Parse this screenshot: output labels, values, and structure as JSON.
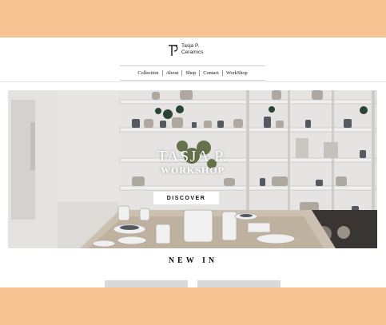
{
  "brand": {
    "line1": "Tasja P.",
    "line2": "Ceramics",
    "logo_icon": "tp-logo-icon"
  },
  "nav": {
    "items": [
      "Collection",
      "About",
      "Shop",
      "Contact",
      "WorkShop"
    ]
  },
  "hero": {
    "title_line1": "TASJA P.",
    "title_line2": "WORKSHOP",
    "button_label": "DISCOVER"
  },
  "section": {
    "heading": "NEW IN"
  },
  "colors": {
    "page_background": "#f6c393",
    "site_background": "#ffffff",
    "button_background": "#ffffff",
    "text_dark": "#111111"
  }
}
